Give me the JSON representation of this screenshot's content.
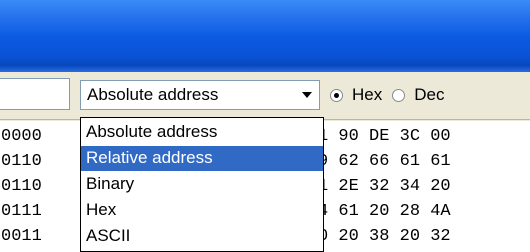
{
  "toolbar": {
    "address_mode": {
      "value": "Absolute address",
      "options": [
        {
          "label": "Absolute address",
          "selected": false
        },
        {
          "label": "Relative address",
          "selected": true
        },
        {
          "label": "Binary",
          "selected": false
        },
        {
          "label": "Hex",
          "selected": false
        },
        {
          "label": "ASCII",
          "selected": false
        }
      ]
    },
    "radix": {
      "options": [
        {
          "label": "Hex",
          "checked": true
        },
        {
          "label": "Dec",
          "checked": false
        }
      ]
    }
  },
  "hex_view": {
    "rows": [
      {
        "address": "0000",
        "bytes": "1 90 DE 3C 00"
      },
      {
        "address": "0110",
        "bytes": "9 62 66 61 61"
      },
      {
        "address": "0110",
        "bytes": "1 2E 32 34 20"
      },
      {
        "address": "0111",
        "bytes": "4 61 20 28 4A"
      },
      {
        "address": "0011",
        "bytes": "0 20 38 20 32"
      }
    ]
  },
  "colors": {
    "titlebar": "#0a52d6",
    "selection": "#316ac5",
    "address_column": "#f7e9fb"
  }
}
